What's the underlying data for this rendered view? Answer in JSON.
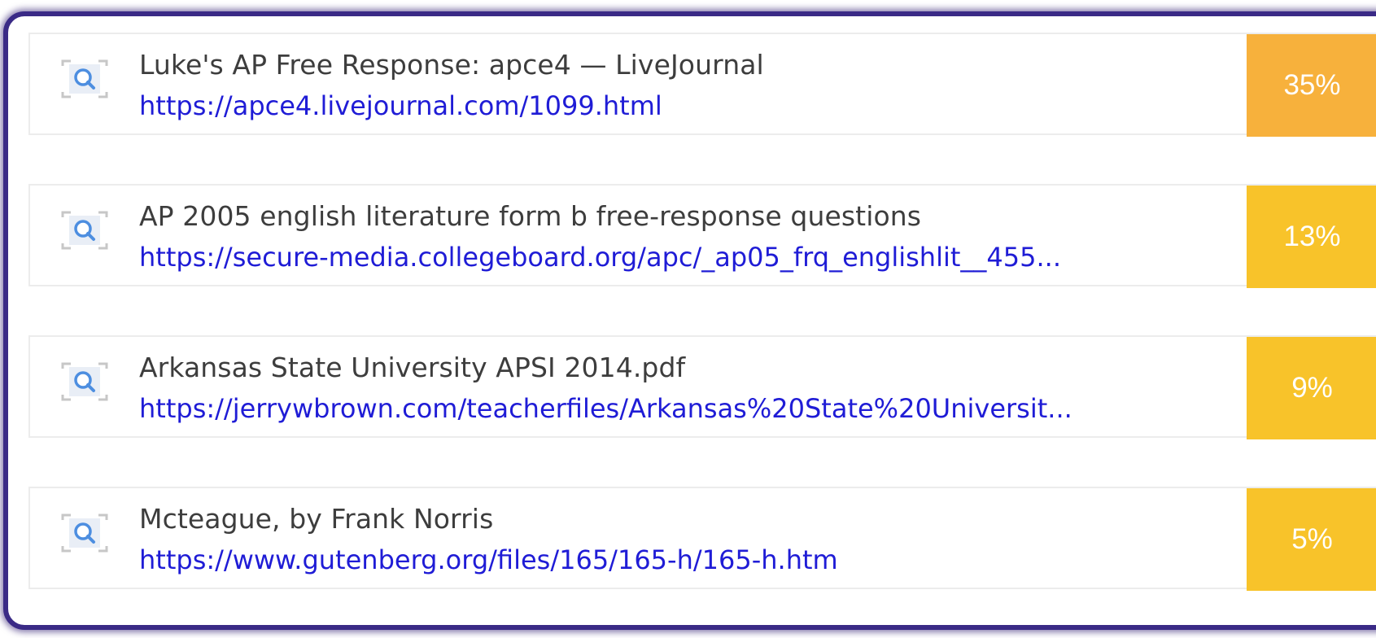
{
  "results": [
    {
      "title": "Luke's AP Free Response: apce4 — LiveJournal",
      "url": "https://apce4.livejournal.com/1099.html",
      "percent": "35%",
      "percent_color": "#f7b13c"
    },
    {
      "title": "AP 2005 english literature form b free-response questions",
      "url": "https://secure-media.collegeboard.org/apc/_ap05_frq_englishlit__455...",
      "percent": "13%",
      "percent_color": "#f8c32a"
    },
    {
      "title": "Arkansas State University APSI 2014.pdf",
      "url": "https://jerrywbrown.com/teacherfiles/Arkansas%20State%20Universit...",
      "percent": "9%",
      "percent_color": "#f8c32a"
    },
    {
      "title": "Mcteague, by Frank Norris",
      "url": "https://www.gutenberg.org/files/165/165-h/165-h.htm",
      "percent": "5%",
      "percent_color": "#f8c32a"
    }
  ],
  "icons": {
    "result_icon": "search-icon"
  }
}
